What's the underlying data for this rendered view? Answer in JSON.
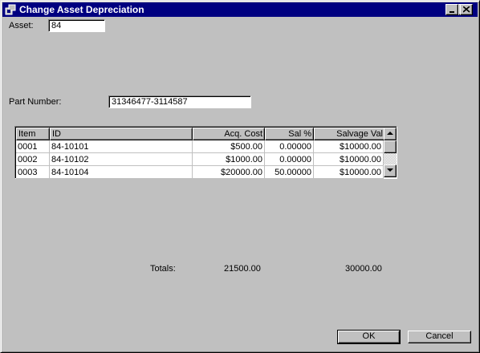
{
  "window": {
    "title": "Change Asset Depreciation"
  },
  "form": {
    "asset_label": "Asset:",
    "asset_value": "84",
    "part_number_label": "Part Number:",
    "part_number_value": "31346477-3114587"
  },
  "grid": {
    "columns": [
      "Item",
      "ID",
      "Acq. Cost",
      "Sal %",
      "Salvage Val"
    ],
    "rows": [
      [
        "0001",
        "84-10101",
        "$500.00",
        "0.00000",
        "$10000.00"
      ],
      [
        "0002",
        "84-10102",
        "$1000.00",
        "0.00000",
        "$10000.00"
      ],
      [
        "0003",
        "84-10104",
        "$20000.00",
        "50.00000",
        "$10000.00"
      ]
    ]
  },
  "totals": {
    "label": "Totals:",
    "acq_cost_total": "21500.00",
    "salvage_total": "30000.00"
  },
  "buttons": {
    "ok": "OK",
    "cancel": "Cancel"
  },
  "icons": {
    "title_icon": "app-icon",
    "minimize": "minimize-icon",
    "maximize": "maximize-icon",
    "close": "close-icon",
    "scroll_up": "scroll-up-arrow-icon",
    "scroll_down": "scroll-down-arrow-icon"
  }
}
